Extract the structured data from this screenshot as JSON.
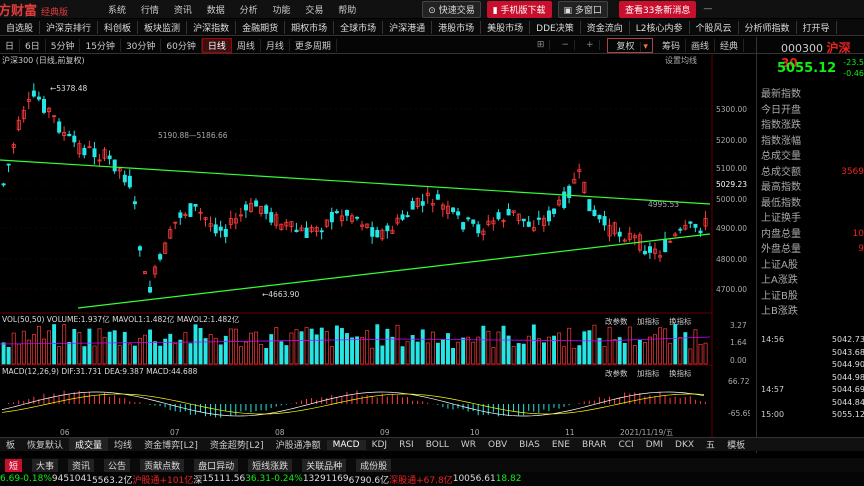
{
  "titlebar": {
    "brand": "方财富",
    "edition": "经典版",
    "menu": [
      "系统",
      "行情",
      "资讯",
      "数据",
      "分析",
      "功能",
      "交易",
      "帮助"
    ],
    "btn_quick_trade": "快速交易",
    "btn_mobile": "手机版下载",
    "btn_assistant": "多窗口",
    "news_btn": "查看33条新消息",
    "btn_minimize": "—",
    "btn_restore": "□",
    "btn_close": "✕"
  },
  "nav": [
    "自选股",
    "沪深京排行",
    "科创板",
    "板块监测",
    "沪深指数",
    "金融期货",
    "期权市场",
    "全球市场",
    "沪深港通",
    "港股市场",
    "美股市场",
    "DDE决策",
    "资金流向",
    "L2核心内参",
    "个股风云",
    "分析师指数",
    "打开导"
  ],
  "periods": [
    "日",
    "6日",
    "5分钟",
    "15分钟",
    "30分钟",
    "60分钟",
    "日线",
    "周线",
    "月线",
    "更多周期"
  ],
  "active_period": "日线",
  "toolbar": {
    "fuquan": "复权",
    "btn_chip": "筹码",
    "btn_draw": "画线",
    "btn_classic": "经典"
  },
  "chart": {
    "title": "沪深300 (日线,前复权)",
    "settings_label": "设置均线",
    "price_ticks": [
      "5300.00",
      "5200.00",
      "5100.00",
      "5029.23",
      "5000.00",
      "4900.00",
      "4800.00",
      "4700.00"
    ],
    "high_label": "5378.48",
    "low_label": "4663.90",
    "mid_label": "5190.88—5186.66",
    "right_label": "4995.53",
    "x_labels": [
      "06",
      "07",
      "08",
      "09",
      "10",
      "11",
      "2021/11/19/五"
    ],
    "vol_header": "VOL(50,50)  VOLUME:1.937亿  MAVOL1:1.482亿  MAVOL2:1.482亿",
    "vol_ticks": [
      "3.27",
      "1.64",
      "0.00"
    ],
    "macd_header": "MACD(12,26,9)  DIF:31.731  DEA:9.387  MACD:44.688",
    "macd_ticks": [
      "66.72",
      "-65.69"
    ],
    "panel_btns": [
      "改参数",
      "加指标",
      "换指标"
    ]
  },
  "side": {
    "code": "000300",
    "name": "沪深30",
    "price": "5055.12",
    "chg": "-23.5",
    "pct": "-0.46",
    "labels": [
      "最新指数",
      "今日开盘",
      "指数涨跌",
      "指数涨幅",
      "总成交量",
      "总成交额",
      "最高指数",
      "最低指数",
      "上证换手",
      "内盘总量",
      "外盘总量",
      "上证A股",
      "上A涨跌",
      "上证B股",
      "上B涨跌"
    ],
    "values": [
      "",
      "",
      "",
      "",
      "",
      "3569",
      "",
      "",
      "",
      "10",
      "9",
      "",
      "",
      "",
      ""
    ],
    "ticks": [
      {
        "t": "14:56",
        "p": "5042.73"
      },
      {
        "t": "",
        "p": "5043.68"
      },
      {
        "t": "",
        "p": "5044.90"
      },
      {
        "t": "",
        "p": "5044.98"
      },
      {
        "t": "14:57",
        "p": "5044.69"
      },
      {
        "t": "",
        "p": "5044.84"
      },
      {
        "t": "15:00",
        "p": "5055.12"
      }
    ],
    "tabs": [
      "分笔",
      "分时",
      "分价"
    ]
  },
  "bottomtabs": [
    "板",
    "恢复默认",
    "成交量",
    "均线",
    "资金博弈[L2]",
    "资金超势[L2]",
    "沪股通净额",
    "MACD",
    "KDJ",
    "RSI",
    "BOLL",
    "WR",
    "OBV",
    "BIAS",
    "ENE",
    "BRAR",
    "CCI",
    "DMI",
    "DKX",
    "五",
    "模板"
  ],
  "status": {
    "tabs": [
      "短",
      "大事",
      "资讯",
      "公告",
      "贡献点数",
      "盘口异动",
      "短线涨跌",
      "关联品种",
      "成份股"
    ],
    "row": [
      "6.69",
      "-0.18%",
      "945",
      "1041",
      "5563.2亿",
      "沪股通",
      "+101亿",
      "深",
      "15111.56",
      "36.31",
      "-0.24%",
      "1329",
      "1169",
      "6790.6亿",
      "深股通",
      "+67.8亿",
      "10056.61",
      "18.82"
    ]
  }
}
